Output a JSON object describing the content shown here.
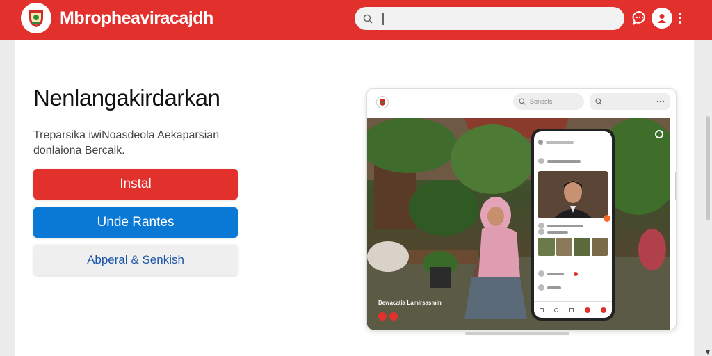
{
  "header": {
    "brand": "Mbropheaviracajdh",
    "search_placeholder": ""
  },
  "main": {
    "title": "Nenlangakirdarkan",
    "description": "Treparsika iwiNoasdeola Aekaparsian donlaiona Bercaik.",
    "buttons": {
      "primary": "Instal",
      "secondary": "Unde Rantes",
      "tertiary": "Abperal & Senkish"
    }
  },
  "preview": {
    "search_label": "Bonosts",
    "caption": "Dewacatia Lamirsasmin"
  },
  "colors": {
    "brand_red": "#e2312c",
    "blue": "#0a79d6"
  }
}
